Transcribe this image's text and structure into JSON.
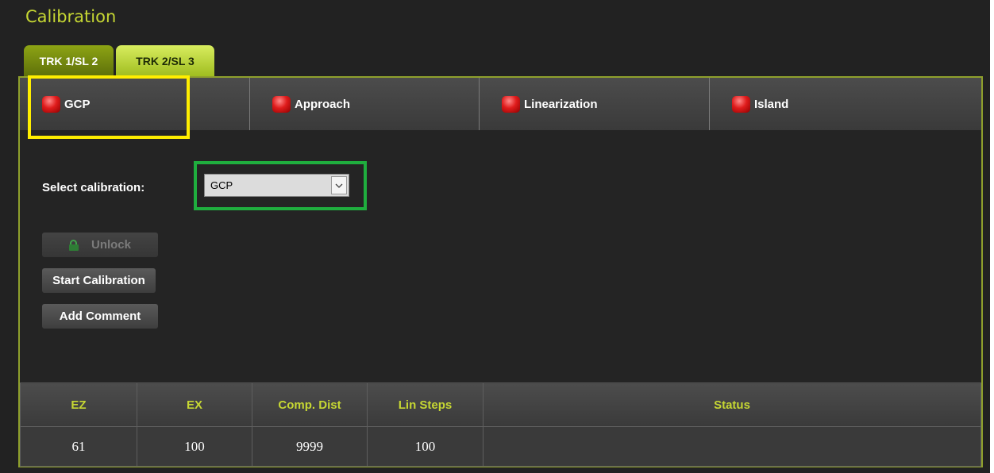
{
  "app": {
    "title": "Calibration"
  },
  "tabs": [
    {
      "label": "TRK 1/SL 2",
      "active": true
    },
    {
      "label": "TRK 2/SL 3",
      "active": false
    }
  ],
  "calibrations": [
    {
      "label": "GCP",
      "status_color": "#e01c1c"
    },
    {
      "label": "Approach",
      "status_color": "#e01c1c"
    },
    {
      "label": "Linearization",
      "status_color": "#e01c1c"
    },
    {
      "label": "Island",
      "status_color": "#e01c1c"
    }
  ],
  "select": {
    "label": "Select calibration:",
    "value": "GCP"
  },
  "buttons": {
    "unlock": "Unlock",
    "start": "Start Calibration",
    "comment": "Add Comment"
  },
  "table": {
    "headers": [
      "EZ",
      "EX",
      "Comp. Dist",
      "Lin Steps",
      "Status"
    ],
    "values": [
      "61",
      "100",
      "9999",
      "100",
      ""
    ]
  },
  "colors": {
    "accent": "#c6d733",
    "highlight_yellow": "#ffee00",
    "highlight_green": "#1fae3e",
    "led_red": "#e01c1c"
  },
  "icons": [
    "status-led-icon",
    "lock-icon",
    "chevron-down-icon"
  ]
}
